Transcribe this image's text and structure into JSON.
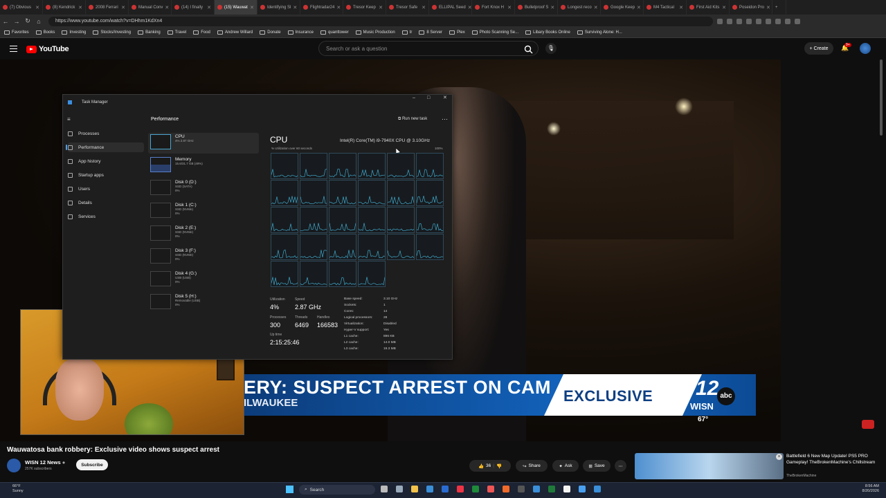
{
  "browser": {
    "tabs": [
      {
        "label": "(7) Obvious",
        "active": false
      },
      {
        "label": "(8) Kendrick",
        "active": false
      },
      {
        "label": "2008 Ferrari",
        "active": false
      },
      {
        "label": "Manual Conv",
        "active": false
      },
      {
        "label": "(14) I finally",
        "active": false
      },
      {
        "label": "(15) Wauwat",
        "active": true
      },
      {
        "label": "Identifying Sl",
        "active": false
      },
      {
        "label": "Flightradar24",
        "active": false
      },
      {
        "label": "Tresor Keep",
        "active": false
      },
      {
        "label": "Tresor Safe",
        "active": false
      },
      {
        "label": "ELLIPAL Seed",
        "active": false
      },
      {
        "label": "Fort Knox H",
        "active": false
      },
      {
        "label": "Bulletproof S",
        "active": false
      },
      {
        "label": "Longest reco",
        "active": false
      },
      {
        "label": "Google Keep",
        "active": false
      },
      {
        "label": "M4 Tactical",
        "active": false
      },
      {
        "label": "First Aid Kits",
        "active": false
      },
      {
        "label": "Poseidon Pro",
        "active": false
      }
    ],
    "url": "https://www.youtube.com/watch?v=DHhm1KdXn4",
    "bookmarks": [
      "Favorites",
      "Books",
      "Investing",
      "Stocks/Investing",
      "Banking",
      "Travel",
      "Food",
      "Andrew Willard",
      "Donate",
      "Insurance",
      "quanttower",
      "Music Production",
      "tr",
      "8 Server",
      "Plex",
      "Photo Scanning Se...",
      "Libary Books Online",
      "Surviving Alone: H..."
    ]
  },
  "youtube": {
    "logo": "YouTube",
    "search_placeholder": "Search or ask a question",
    "create_label": "Create",
    "notifications": "9+",
    "video_title": "Wauwatosa bank robbery: Exclusive video shows suspect arrest",
    "channel": "WISN 12 News",
    "subscribers": "257K subscribers",
    "subscribe_label": "Subscribe",
    "likes": "36",
    "share_label": "Share",
    "ask_label": "Ask",
    "save_label": "Save",
    "recommendation": {
      "title": "Battlefield 6 New Map Update! PS5 PRO Gameplay! TheBrokenMachine's Chillstream",
      "channel": "TheBrokenMachine"
    }
  },
  "broadcast": {
    "headline": "ERY: SUSPECT ARREST ON CAM",
    "location": "ILWAUKEE",
    "exclusive": "EXCLUSIVE",
    "station": "WISN",
    "station_number": "12",
    "network": "abc",
    "temperature": "67°"
  },
  "task_manager": {
    "title": "Task Manager",
    "nav": [
      "Processes",
      "Performance",
      "App history",
      "Startup apps",
      "Users",
      "Details",
      "Services"
    ],
    "selected_nav": "Performance",
    "header": "Performance",
    "run_new_task": "Run new task",
    "devices": [
      {
        "name": "CPU",
        "sub": "4% 2.87 GHz"
      },
      {
        "name": "Memory",
        "sub": "15.6/31.7 GB (49%)"
      },
      {
        "name": "Disk 0 (D:)",
        "sub": "SSD (SATA)",
        "sub2": "0%"
      },
      {
        "name": "Disk 1 (C:)",
        "sub": "SSD (NVMe)",
        "sub2": "0%"
      },
      {
        "name": "Disk 2 (E:)",
        "sub": "SSD (NVMe)",
        "sub2": "0%"
      },
      {
        "name": "Disk 3 (F:)",
        "sub": "SSD (NVMe)",
        "sub2": "0%"
      },
      {
        "name": "Disk 4 (G:)",
        "sub": "USB (USB)",
        "sub2": "0%"
      },
      {
        "name": "Disk 5 (H:)",
        "sub": "Removable (USB)",
        "sub2": "0%"
      }
    ],
    "cpu_title": "CPU",
    "cpu_model": "Intel(R) Core(TM) i9-7940X CPU @ 3.10GHz",
    "util_label": "% Utilization over 60 seconds",
    "util_max": "100%",
    "stats": {
      "utilization_label": "Utilization",
      "utilization": "4%",
      "speed_label": "Speed",
      "speed": "2.87 GHz",
      "processes_label": "Processes",
      "processes": "300",
      "threads_label": "Threads",
      "threads": "6469",
      "handles_label": "Handles",
      "handles": "166583",
      "uptime_label": "Up time",
      "uptime": "2:15:25:46"
    },
    "specs": [
      {
        "k": "Base speed:",
        "v": "3.10 GHz"
      },
      {
        "k": "Sockets:",
        "v": "1"
      },
      {
        "k": "Cores:",
        "v": "14"
      },
      {
        "k": "Logical processors:",
        "v": "28"
      },
      {
        "k": "Virtualization:",
        "v": "Disabled"
      },
      {
        "k": "Hyper-V support:",
        "v": "Yes"
      },
      {
        "k": "L1 cache:",
        "v": "896 KB"
      },
      {
        "k": "L2 cache:",
        "v": "14.0 MB"
      },
      {
        "k": "L3 cache:",
        "v": "19.3 MB"
      }
    ]
  },
  "taskbar": {
    "weather_temp": "66°F",
    "weather_desc": "Sunny",
    "search_label": "Search",
    "time": "8:56 AM",
    "date": "8/20/2026"
  },
  "colors": {
    "accent": "#4aa0f0",
    "youtube_red": "#ff0000",
    "banner_blue": "#1366c2"
  }
}
